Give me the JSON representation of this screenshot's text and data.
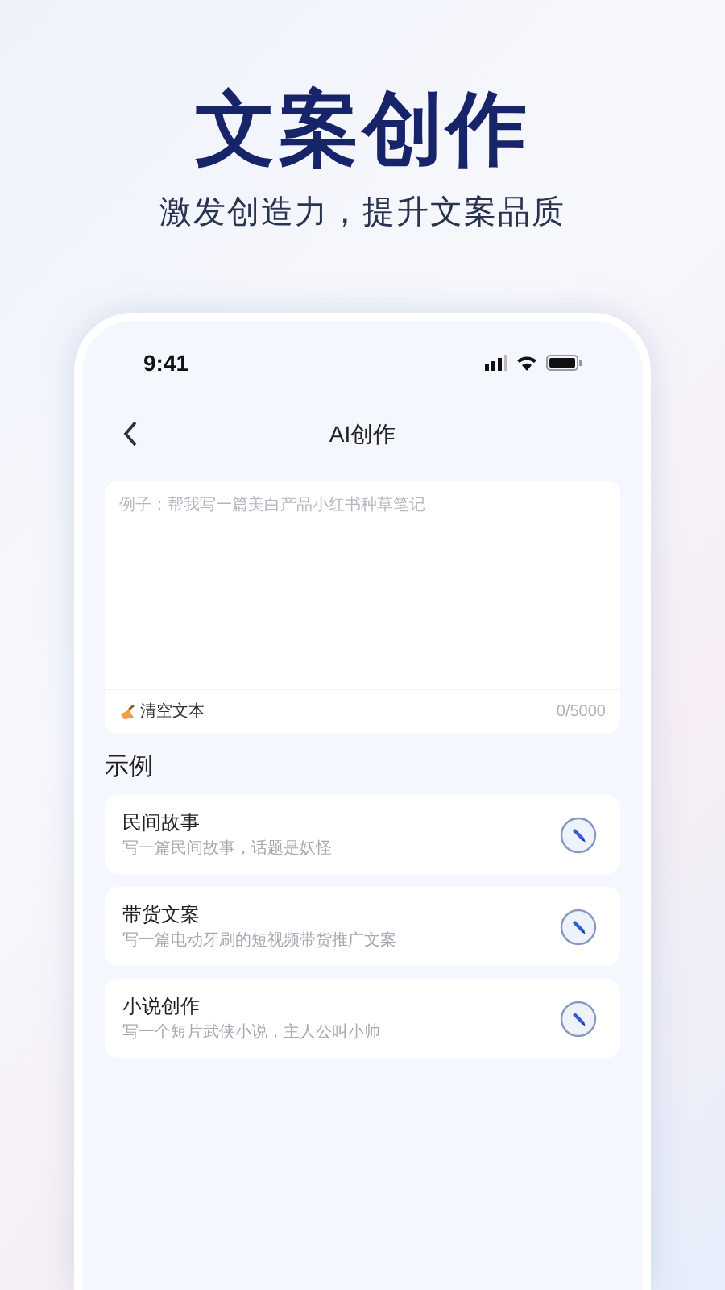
{
  "headline": "文案创作",
  "subtitle": "激发创造力，提升文案品质",
  "status_bar": {
    "time": "9:41"
  },
  "nav": {
    "title": "AI创作"
  },
  "editor": {
    "placeholder": "例子：帮我写一篇美白产品小红书种草笔记",
    "clear_label": "清空文本",
    "counter": "0/5000"
  },
  "examples": {
    "heading": "示例",
    "items": [
      {
        "title": "民间故事",
        "prompt": "写一篇民间故事，话题是妖怪"
      },
      {
        "title": "带货文案",
        "prompt": "写一篇电动牙刷的短视频带货推广文案"
      },
      {
        "title": "小说创作",
        "prompt": "写一个短片武侠小说，主人公叫小帅"
      }
    ]
  }
}
